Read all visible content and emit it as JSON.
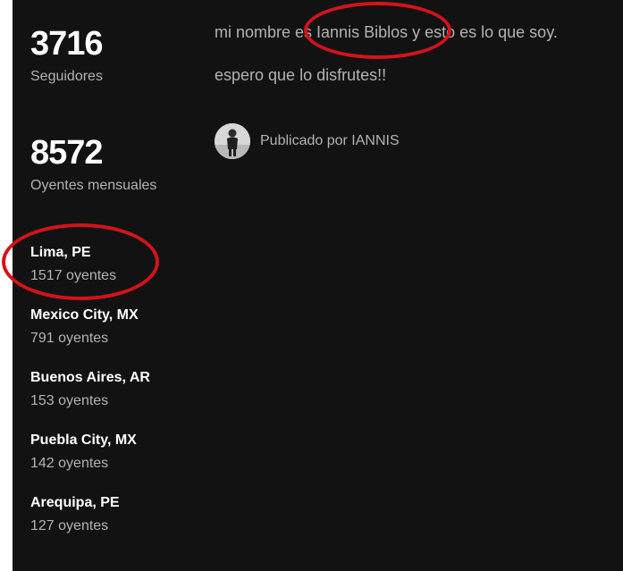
{
  "stats": {
    "followers": {
      "number": "3716",
      "label": "Seguidores"
    },
    "monthly_listeners": {
      "number": "8572",
      "label": "Oyentes mensuales"
    }
  },
  "top_cities": [
    {
      "name": "Lima, PE",
      "listeners": "1517 oyentes"
    },
    {
      "name": "Mexico City, MX",
      "listeners": "791 oyentes"
    },
    {
      "name": "Buenos Aires, AR",
      "listeners": "153 oyentes"
    },
    {
      "name": "Puebla City, MX",
      "listeners": "142 oyentes"
    },
    {
      "name": "Arequipa, PE",
      "listeners": "127 oyentes"
    }
  ],
  "bio": {
    "line1": "mi nombre es Iannis Biblos y esto es lo que soy.",
    "line2": "espero que lo disfrutes!!"
  },
  "author": {
    "text": "Publicado por IANNIS"
  },
  "colors": {
    "background": "#121212",
    "primary_text": "#ffffff",
    "secondary_text": "#b3b3b3",
    "annotation_circle": "#d4131a"
  }
}
